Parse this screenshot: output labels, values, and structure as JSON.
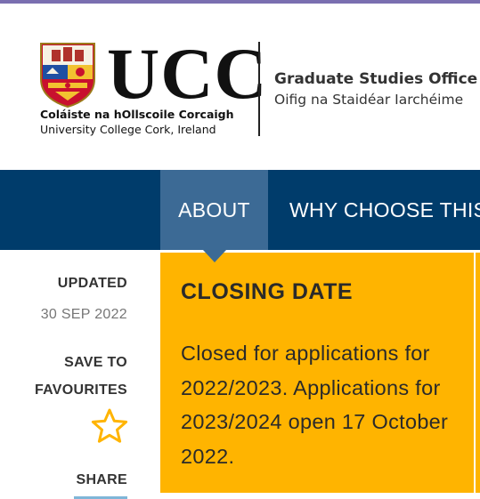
{
  "header": {
    "logo_word": "UCC",
    "logo_irish": "Coláiste na hOllscoile Corcaigh",
    "logo_english": "University College Cork, Ireland",
    "office_title": "Graduate Studies Office",
    "office_irish": "Oifig na Staidéar Iarchéime",
    "accent_color": "#7a6fb0"
  },
  "nav": {
    "tabs": [
      {
        "label": "ABOUT",
        "active": true
      },
      {
        "label": "WHY CHOOSE THIS",
        "active": false
      }
    ],
    "background_color": "#003c6b",
    "active_color": "#3c6a95"
  },
  "sidebar": {
    "updated_label": "UPDATED",
    "updated_value": "30 SEP 2022",
    "save_label_line1": "SAVE TO",
    "save_label_line2": "FAVOURITES",
    "favourite_icon": "star-outline-icon",
    "favourite_color": "#ffb400",
    "share_label": "SHARE"
  },
  "closing": {
    "title": "CLOSING DATE",
    "text": "Closed for applications for 2022/2023. Applications for 2023/2024 open 17 October 2022.",
    "card_color": "#ffb400"
  }
}
